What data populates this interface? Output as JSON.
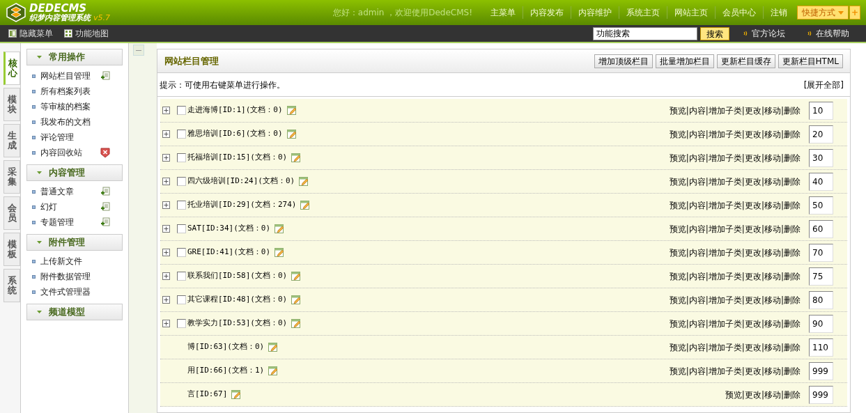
{
  "header": {
    "logo_title": "DEDECMS",
    "logo_subtitle": "织梦内容管理系统",
    "version": "v5.7",
    "greeting": "您好：admin ，欢迎使用DedeCMS!",
    "nav": [
      "主菜单",
      "内容发布",
      "内容维护",
      "系统主页",
      "网站主页",
      "会员中心",
      "注销"
    ],
    "shortcut": "快捷方式",
    "add": "+"
  },
  "toolbar": {
    "items": [
      {
        "label": "隐藏菜单",
        "kind": "hide"
      },
      {
        "label": "功能地图",
        "kind": "map"
      }
    ],
    "search": {
      "value": "功能搜索"
    },
    "search_button": "搜索",
    "links": [
      "官方论坛",
      "在线帮助"
    ]
  },
  "side_tabs": [
    {
      "label": "核心",
      "selected": true
    },
    {
      "label": "模块",
      "selected": false
    },
    {
      "label": "生成",
      "selected": false
    },
    {
      "label": "采集",
      "selected": false
    },
    {
      "label": "会员",
      "selected": false
    },
    {
      "label": "模板",
      "selected": false
    },
    {
      "label": "系统",
      "selected": false
    }
  ],
  "menu": [
    {
      "title": "常用操作",
      "items": [
        {
          "label": "网站栏目管理",
          "kind": "add"
        },
        {
          "label": "所有档案列表",
          "kind": "plain"
        },
        {
          "label": "等审核的档案",
          "kind": "plain"
        },
        {
          "label": "我发布的文档",
          "kind": "plain"
        },
        {
          "label": "评论管理",
          "kind": "plain"
        },
        {
          "label": "内容回收站",
          "kind": "delete"
        }
      ]
    },
    {
      "title": "内容管理",
      "items": [
        {
          "label": "普通文章",
          "kind": "add"
        },
        {
          "label": "幻灯",
          "kind": "add"
        },
        {
          "label": "专题管理",
          "kind": "add"
        }
      ]
    },
    {
      "title": "附件管理",
      "items": [
        {
          "label": "上传新文件",
          "kind": "plain"
        },
        {
          "label": "附件数据管理",
          "kind": "plain"
        },
        {
          "label": "文件式管理器",
          "kind": "plain"
        }
      ]
    },
    {
      "title": "频道模型"
    }
  ],
  "panel": {
    "title": "网站栏目管理",
    "buttons": [
      "增加顶级栏目",
      "批量增加栏目",
      "更新栏目缓存",
      "更新栏目HTML"
    ],
    "hint": "提示：可使用右键菜单进行操作。",
    "expand_all": "[展开全部]",
    "rows": [
      {
        "kind": "full",
        "checked": false,
        "name": "走进海博[ID:1](文档：0)",
        "actions": "预览|内容|增加子类|更改|移动|删除",
        "order": "10"
      },
      {
        "kind": "full",
        "checked": false,
        "name": "雅思培训[ID:6](文档：0)",
        "actions": "预览|内容|增加子类|更改|移动|删除",
        "order": "20"
      },
      {
        "kind": "full",
        "checked": false,
        "name": "托福培训[ID:15](文档：0)",
        "actions": "预览|内容|增加子类|更改|移动|删除",
        "order": "30"
      },
      {
        "kind": "full",
        "checked": false,
        "name": "四六级培训[ID:24](文档：0)",
        "actions": "预览|内容|增加子类|更改|移动|删除",
        "order": "40"
      },
      {
        "kind": "full",
        "checked": false,
        "name": "托业培训[ID:29](文档：274)",
        "actions": "预览|内容|增加子类|更改|移动|删除",
        "order": "50"
      },
      {
        "kind": "full",
        "checked": false,
        "name": "SAT[ID:34](文档：0)",
        "actions": "预览|内容|增加子类|更改|移动|删除",
        "order": "60"
      },
      {
        "kind": "full",
        "checked": false,
        "name": "GRE[ID:41](文档：0)",
        "actions": "预览|内容|增加子类|更改|移动|删除",
        "order": "70"
      },
      {
        "kind": "full",
        "checked": false,
        "name": "联系我们[ID:58](文档：0)",
        "actions": "预览|内容|增加子类|更改|移动|删除",
        "order": "75"
      },
      {
        "kind": "full",
        "checked": false,
        "name": "其它课程[ID:48](文档：0)",
        "actions": "预览|内容|增加子类|更改|移动|删除",
        "order": "80"
      },
      {
        "kind": "full",
        "checked": false,
        "name": "教学实力[ID:53](文档：0)",
        "actions": "预览|内容|增加子类|更改|移动|删除",
        "order": "90"
      },
      {
        "kind": "partial",
        "name": "博[ID:63](文档：0)",
        "actions": "预览|内容|增加子类|更改|移动|删除",
        "order": "110"
      },
      {
        "kind": "partial",
        "name": "用[ID:66](文档：1)",
        "actions": "预览|内容|增加子类|更改|移动|删除",
        "order": "999"
      },
      {
        "kind": "partial",
        "name": "言[ID:67]",
        "actions": "预览|更改|移动|删除",
        "order": "999"
      }
    ]
  }
}
